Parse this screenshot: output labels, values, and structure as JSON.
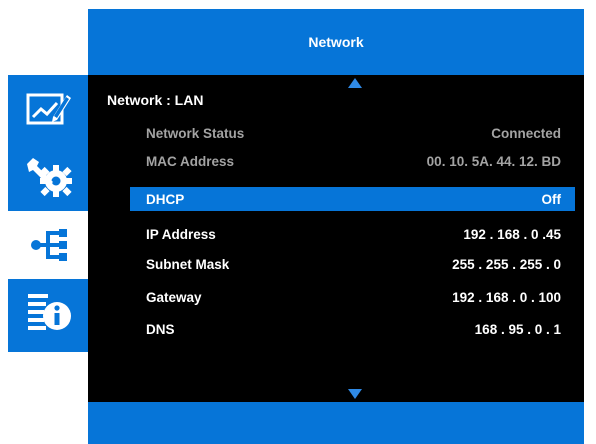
{
  "header": {
    "title": "Network"
  },
  "sidebar": {
    "tabs": [
      {
        "icon": "image-settings-icon",
        "active": false
      },
      {
        "icon": "settings-tools-icon",
        "active": false
      },
      {
        "icon": "network-icon",
        "active": true
      },
      {
        "icon": "information-icon",
        "active": false
      }
    ]
  },
  "colors": {
    "accent": "#0675d8",
    "panel": "#000000",
    "dim_text": "#a3a3a3"
  },
  "main": {
    "section_label": "Network : LAN",
    "info_rows": [
      {
        "label": "Network Status",
        "value": "Connected"
      },
      {
        "label": "MAC Address",
        "value": "00. 10. 5A. 44. 12. BD"
      }
    ],
    "settings": [
      {
        "label": "DHCP",
        "value": "Off",
        "selected": true
      },
      {
        "label": "IP Address",
        "value": "192 . 168 . 0 .45"
      },
      {
        "label": "Subnet Mask",
        "value": "255 . 255 . 255 . 0"
      },
      {
        "label": "Gateway",
        "value": "192 . 168 . 0 . 100"
      },
      {
        "label": "DNS",
        "value": "168 . 95 . 0 . 1"
      }
    ]
  }
}
